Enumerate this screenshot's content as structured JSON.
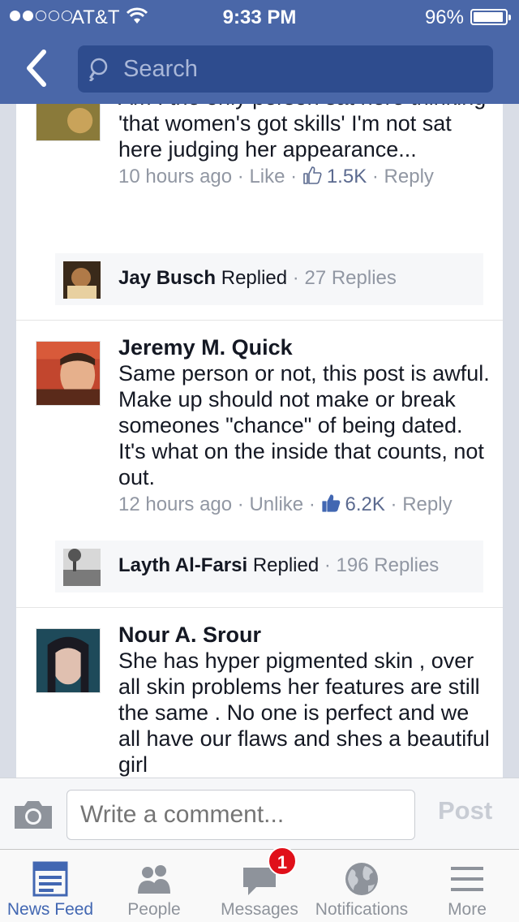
{
  "status_bar": {
    "carrier": "AT&T",
    "time": "9:33 PM",
    "battery": "96%",
    "battery_level": 0.96
  },
  "header": {
    "search_placeholder": "Search"
  },
  "comments": [
    {
      "author": "",
      "text": "Am I the only person sat here thinking 'that women's got skills' I'm not sat here judging her appearance...",
      "time": "10 hours ago",
      "like_action": "Like",
      "likes": "1.5K",
      "reply_action": "Reply",
      "replied_by": "Jay Busch",
      "replied_label": "Replied",
      "reply_count": "27 Replies"
    },
    {
      "author": "Jeremy M. Quick",
      "text": "Same person or not, this post is awful. Make up should not make or break someones \"chance\" of being dated. It's what on the inside that counts, not out.",
      "time": "12 hours ago",
      "like_action": "Unlike",
      "likes": "6.2K",
      "reply_action": "Reply",
      "replied_by": "Layth Al-Farsi",
      "replied_label": "Replied",
      "reply_count": "196 Replies"
    },
    {
      "author": "Nour A. Srour",
      "text": "She has hyper pigmented skin , over all skin problems her features are still the same . No one is perfect and we all have our flaws and shes a beautiful girl"
    }
  ],
  "composer": {
    "placeholder": "Write a comment...",
    "post_label": "Post"
  },
  "tabs": [
    {
      "label": "News Feed",
      "icon": "news-feed-icon",
      "active": true
    },
    {
      "label": "People",
      "icon": "people-icon"
    },
    {
      "label": "Messages",
      "icon": "messages-icon",
      "badge": "1"
    },
    {
      "label": "Notifications",
      "icon": "globe-icon"
    },
    {
      "label": "More",
      "icon": "menu-icon"
    }
  ],
  "colors": {
    "brand_blue": "#4a67a8",
    "search_bg": "#2e4c8e",
    "active_tab": "#4267b2",
    "badge": "#e0101a",
    "meta_gray": "#9197a3"
  }
}
